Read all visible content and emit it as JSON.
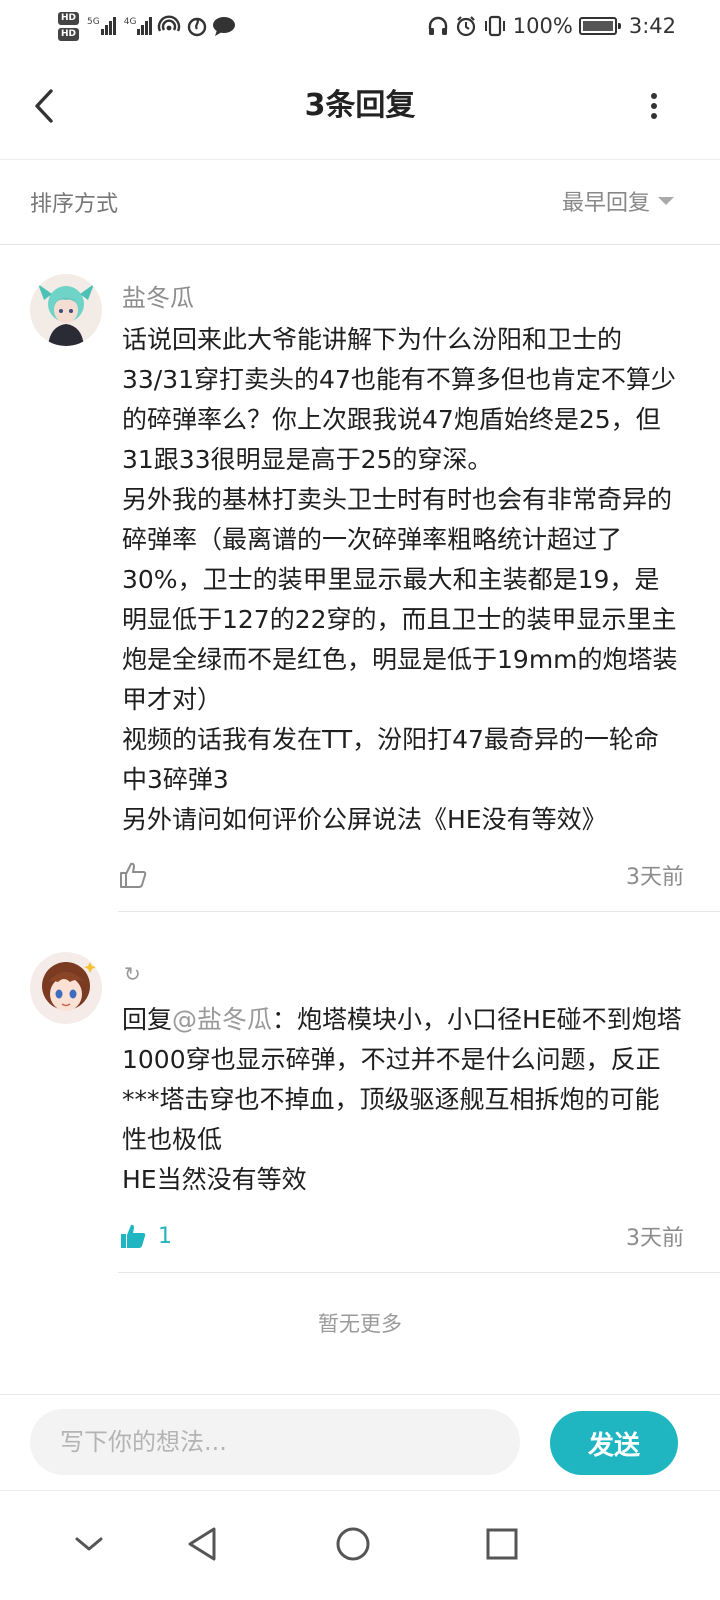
{
  "status_bar": {
    "hd1": "HD",
    "hd2": "HD",
    "net1": "5G",
    "net2": "4G",
    "battery": "100%",
    "time": "3:42"
  },
  "header": {
    "title": "3条回复"
  },
  "sort": {
    "label": "排序方式",
    "value": "最早回复"
  },
  "comments": [
    {
      "username": "盐冬瓜",
      "paragraphs": [
        "话说回来此大爷能讲解下为什么汾阳和卫士的33/31穿打卖头的47也能有不算多但也肯定不算少的碎弹率么？你上次跟我说47炮盾始终是25，但31跟33很明显是高于25的穿深。",
        "另外我的基林打卖头卫士时有时也会有非常奇异的碎弹率（最离谱的一次碎弹率粗略统计超过了30%，卫士的装甲里显示最大和主装都是19，是明显低于127的22穿的，而且卫士的装甲显示里主炮是全绿而不是红色，明显是低于19mm的炮塔装甲才对）",
        "视频的话我有发在TT，汾阳打47最奇异的一轮命中3碎弹3",
        "另外请问如何评价公屏说法《HE没有等效》"
      ],
      "likes": "",
      "time": "3天前"
    },
    {
      "reply_prefix": "回复",
      "mention": "@盐冬瓜",
      "paragraphs": [
        "：炮塔模块小，小口径HE碰不到炮塔1000穿也显示碎弹，不过并不是什么问题，反正***塔击穿也不掉血，顶级驱逐舰互相拆炮的可能性也极低",
        "HE当然没有等效"
      ],
      "likes": "1",
      "time": "3天前"
    }
  ],
  "footer_note": "暂无更多",
  "composer": {
    "placeholder": "写下你的想法...",
    "send_label": "发送"
  },
  "colors": {
    "accent": "#1fb6c1"
  }
}
